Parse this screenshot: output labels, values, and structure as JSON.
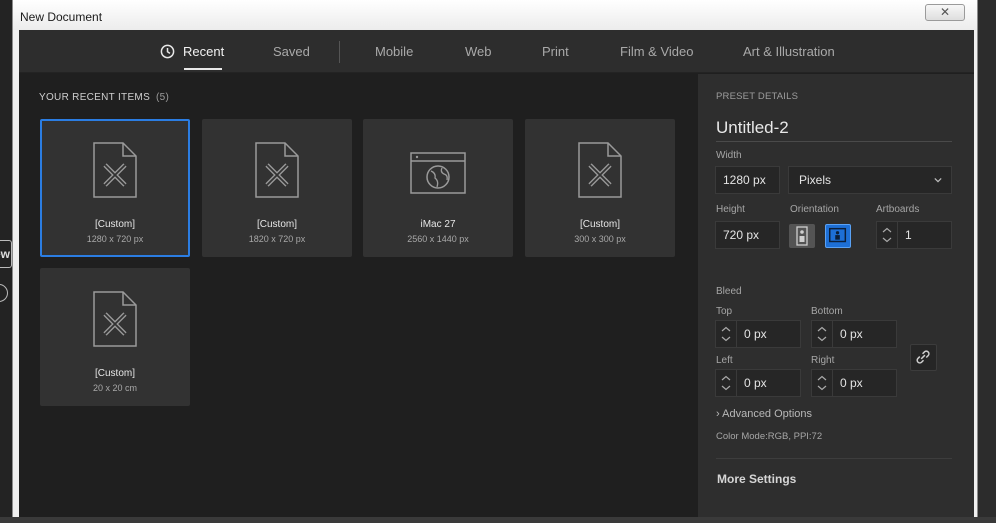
{
  "window": {
    "title": "New Document",
    "close_glyph": "✕"
  },
  "background": {
    "partial_button_text": "ew"
  },
  "tabs": [
    {
      "label": "Recent",
      "active": true
    },
    {
      "label": "Saved"
    },
    {
      "label": "Mobile"
    },
    {
      "label": "Web"
    },
    {
      "label": "Print"
    },
    {
      "label": "Film & Video"
    },
    {
      "label": "Art & Illustration"
    }
  ],
  "recent": {
    "heading": "YOUR RECENT ITEMS",
    "count": "(5)",
    "items": [
      {
        "name": "[Custom]",
        "size": "1280 x 720 px",
        "icon": "document-icon",
        "selected": true
      },
      {
        "name": "[Custom]",
        "size": "1820 x 720 px",
        "icon": "document-icon"
      },
      {
        "name": "iMac 27",
        "size": "2560 x 1440 px",
        "icon": "web-icon"
      },
      {
        "name": "[Custom]",
        "size": "300 x 300 px",
        "icon": "document-icon"
      },
      {
        "name": "[Custom]",
        "size": "20 x 20 cm",
        "icon": "document-icon"
      }
    ]
  },
  "preset": {
    "heading": "PRESET DETAILS",
    "doc_name": "Untitled-2",
    "width_label": "Width",
    "width_value": "1280 px",
    "unit_value": "Pixels",
    "height_label": "Height",
    "height_value": "720 px",
    "orientation_label": "Orientation",
    "orientation": "landscape",
    "artboards_label": "Artboards",
    "artboards_value": "1",
    "bleed_label": "Bleed",
    "top_label": "Top",
    "top_value": "0 px",
    "bottom_label": "Bottom",
    "bottom_value": "0 px",
    "left_label": "Left",
    "left_value": "0 px",
    "right_label": "Right",
    "right_value": "0 px",
    "advanced_label": "Advanced Options",
    "color_mode": "Color Mode:RGB, PPI:72",
    "more_settings": "More Settings"
  },
  "colors": {
    "accent": "#2b7de2",
    "panel": "#2e2e2e",
    "background": "#1f1f1f"
  }
}
